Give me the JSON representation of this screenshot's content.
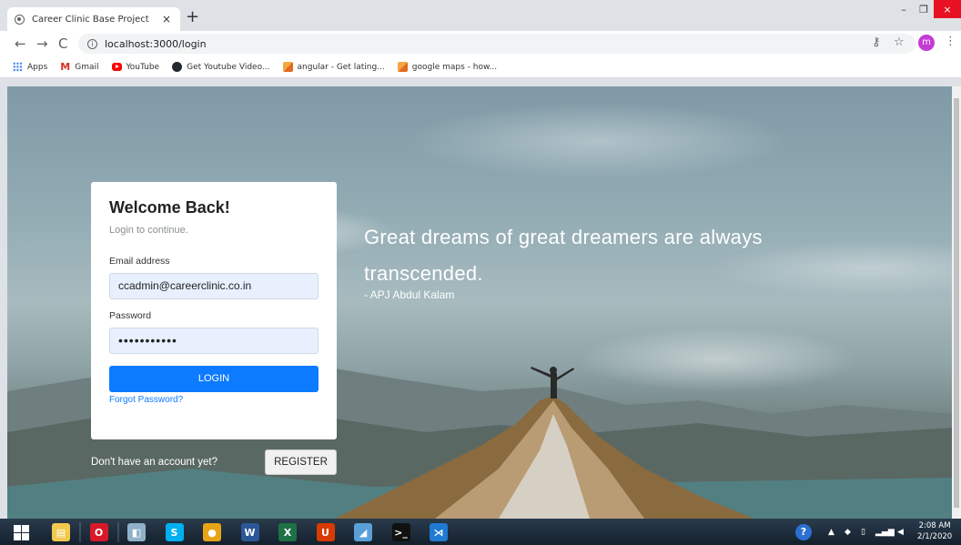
{
  "browser": {
    "tab_title": "Career Clinic Base Project",
    "tab_close": "×",
    "new_tab": "+",
    "url": "localhost:3000/login",
    "window_min": "–",
    "window_max": "❐",
    "window_close": "×",
    "profile_initial": "m",
    "bookmarks": [
      {
        "label": "Apps",
        "icon": "apps-icon"
      },
      {
        "label": "Gmail",
        "icon": "gmail-icon"
      },
      {
        "label": "YouTube",
        "icon": "youtube-icon"
      },
      {
        "label": "Get Youtube Video...",
        "icon": "github-icon"
      },
      {
        "label": "angular - Get lating...",
        "icon": "stackoverflow-icon"
      },
      {
        "label": "google maps - how...",
        "icon": "stackoverflow-icon"
      }
    ]
  },
  "page": {
    "quote_line": "Great dreams of great dreamers are always transcended.",
    "quote_author": "- APJ Abdul Kalam",
    "login": {
      "heading": "Welcome Back!",
      "subtitle": "Login to continue.",
      "email_label": "Email address",
      "email_value": "ccadmin@careerclinic.co.in",
      "password_label": "Password",
      "password_value": "•••••••••••",
      "login_button": "LOGIN",
      "forgot_link": "Forgot Password?"
    },
    "register_prompt": "Don't have an account yet?",
    "register_button": "REGISTER"
  },
  "taskbar": {
    "clock_time": "2:08 AM",
    "clock_date": "2/1/2020",
    "apps": [
      {
        "name": "file-explorer-icon",
        "color": "#f2c94c",
        "glyph": "▤"
      },
      {
        "name": "opera-icon",
        "color": "#d71a28",
        "glyph": "O"
      },
      {
        "name": "photos-icon",
        "color": "#8fb2c9",
        "glyph": "◧"
      },
      {
        "name": "skype-icon",
        "color": "#00aff0",
        "glyph": "S"
      },
      {
        "name": "chrome-icon",
        "color": "#e8a317",
        "glyph": "●"
      },
      {
        "name": "word-icon",
        "color": "#2b5797",
        "glyph": "W"
      },
      {
        "name": "excel-icon",
        "color": "#1e7145",
        "glyph": "X"
      },
      {
        "name": "office-icon",
        "color": "#d83b01",
        "glyph": "U"
      },
      {
        "name": "notepad-icon",
        "color": "#5aa0d8",
        "glyph": "◢"
      },
      {
        "name": "cmd-icon",
        "color": "#111111",
        "glyph": ">_"
      },
      {
        "name": "vscode-icon",
        "color": "#1f7ad1",
        "glyph": "⋊"
      }
    ]
  },
  "colors": {
    "accent": "#0d7bff",
    "close_red": "#e81123",
    "profile": "#c43bd4"
  }
}
